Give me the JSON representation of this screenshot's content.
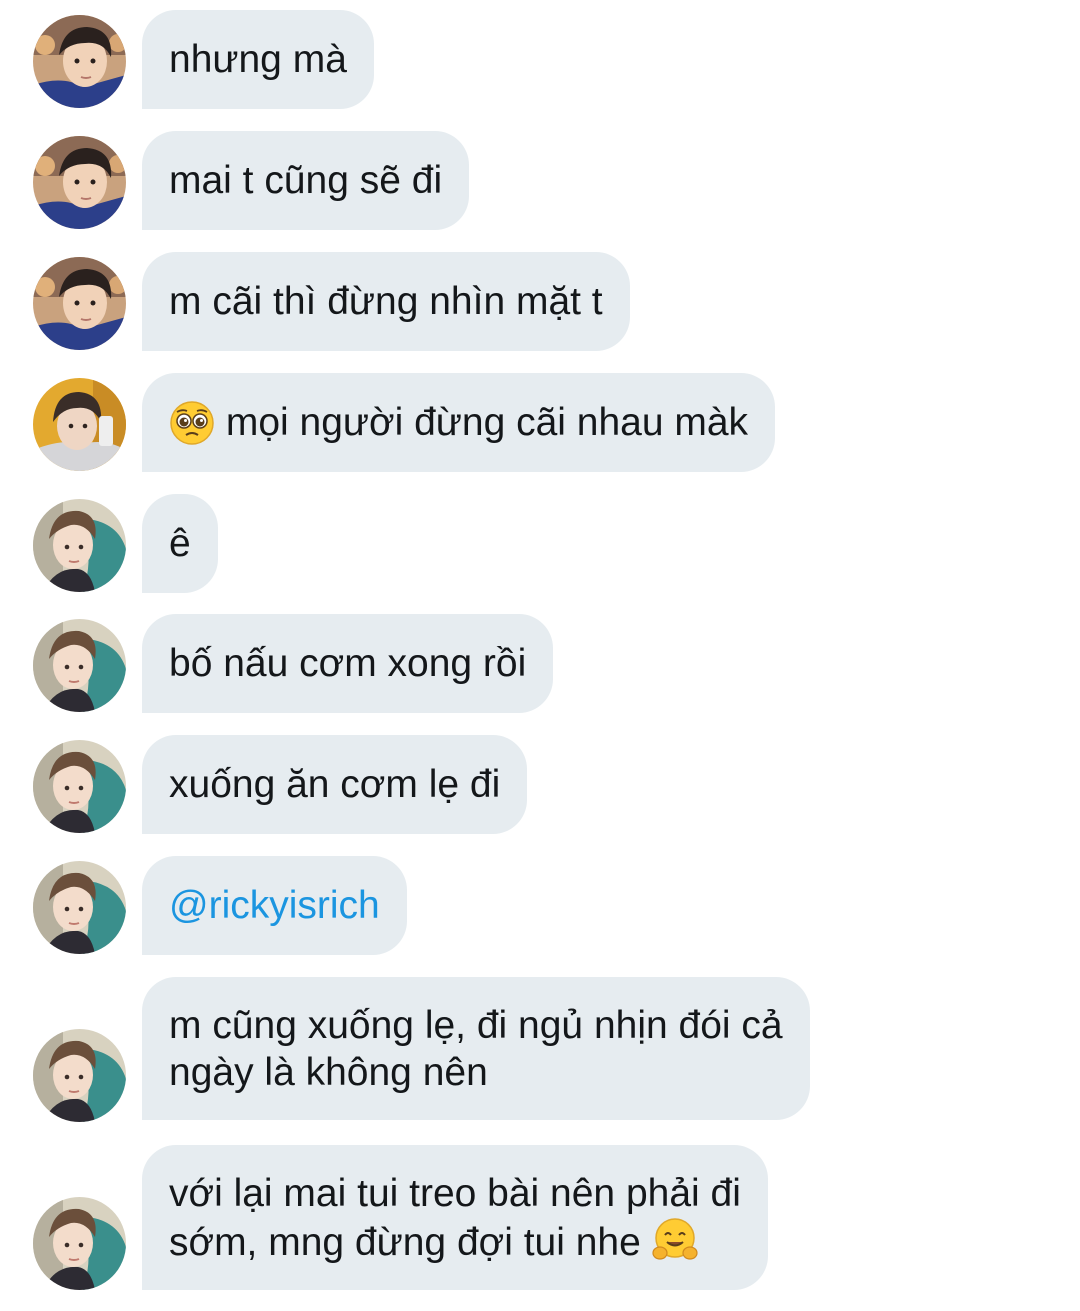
{
  "messages": [
    {
      "text": "nhưng mà"
    },
    {
      "text": "mai t cũng sẽ đi"
    },
    {
      "text": "m cãi thì đừng nhìn mặt t"
    },
    {
      "emoji": "pleading-face-emoji",
      "text": "mọi người đừng cãi nhau màk"
    },
    {
      "text": "ê"
    },
    {
      "text": "bố nấu cơm xong rồi"
    },
    {
      "text": "xuống ăn cơm lẹ đi"
    },
    {
      "mention": "@rickyisrich"
    },
    {
      "line1": "m cũng xuống lẹ, đi ngủ nhịn đói cả",
      "line2": "ngày là không nên"
    },
    {
      "line1": "với lại mai tui treo bài nên phải đi",
      "line2": "sớm, mng đừng đợi tui nhe",
      "emoji": "hugging-face-emoji"
    }
  ],
  "colors": {
    "bubble": "#e6ecf0",
    "text": "#14171a",
    "mention": "#1b95e0",
    "background": "#ffffff"
  }
}
